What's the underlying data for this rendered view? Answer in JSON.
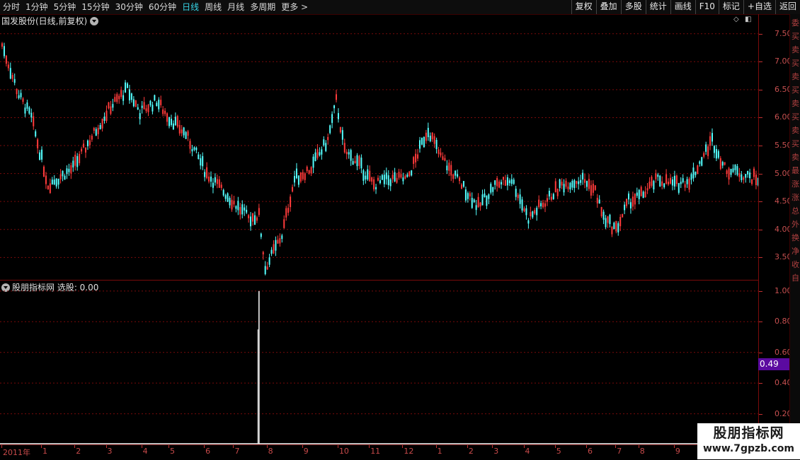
{
  "toolbar": {
    "periods": [
      {
        "label": "分时",
        "active": false
      },
      {
        "label": "1分钟",
        "active": false
      },
      {
        "label": "5分钟",
        "active": false
      },
      {
        "label": "15分钟",
        "active": false
      },
      {
        "label": "30分钟",
        "active": false
      },
      {
        "label": "60分钟",
        "active": false
      },
      {
        "label": "日线",
        "active": true
      },
      {
        "label": "周线",
        "active": false
      },
      {
        "label": "月线",
        "active": false
      },
      {
        "label": "多周期",
        "active": false
      },
      {
        "label": "更多 >",
        "active": false
      }
    ],
    "right_tools": [
      "复权",
      "叠加",
      "多股",
      "统计",
      "画线",
      "F10",
      "标记",
      "+自选",
      "返回"
    ]
  },
  "main_panel": {
    "title": "国发股份(日线,前复权)",
    "y_ticks": [
      "7.50",
      "7.00",
      "6.50",
      "6.00",
      "5.50",
      "5.00",
      "4.50",
      "4.00",
      "3.50"
    ],
    "colors": {
      "up": "#ff3b3b",
      "down": "#54ffff",
      "grid": "#7a0b0b"
    }
  },
  "sub_panel": {
    "title": "股朋指标网 选股: 0.00",
    "y_ticks": [
      "1.00",
      "0.80",
      "0.60",
      "0.40",
      "0.20"
    ],
    "current_value": "0.49"
  },
  "date_axis": {
    "labels": [
      "2011年",
      "1",
      "2",
      "3",
      "4",
      "5",
      "6",
      "7",
      "8",
      "9",
      "10",
      "11",
      "12",
      "1",
      "2",
      "3",
      "4",
      "5",
      "6",
      "7",
      "8",
      "9"
    ]
  },
  "side_strip": {
    "chars": [
      "委",
      "买",
      "卖",
      "买",
      "卖",
      "买",
      "卖",
      "买",
      "卖",
      "买",
      "卖",
      "最",
      "涨",
      "涨",
      "总",
      "外",
      "换",
      "净",
      "收",
      "自"
    ]
  },
  "chart_data": {
    "type": "candlestick",
    "title": "国发股份(日线,前复权)",
    "ylim": [
      3.1,
      7.85
    ],
    "anchors": [
      [
        0,
        7.3
      ],
      [
        8,
        6.4
      ],
      [
        14,
        6.0
      ],
      [
        22,
        4.8
      ],
      [
        34,
        5.1
      ],
      [
        42,
        5.6
      ],
      [
        52,
        6.2
      ],
      [
        60,
        6.5
      ],
      [
        66,
        6.1
      ],
      [
        74,
        6.3
      ],
      [
        80,
        6.0
      ],
      [
        88,
        5.7
      ],
      [
        98,
        5.0
      ],
      [
        108,
        4.6
      ],
      [
        118,
        4.2
      ],
      [
        123,
        4.25
      ],
      [
        126,
        3.3
      ],
      [
        134,
        3.9
      ],
      [
        140,
        4.9
      ],
      [
        148,
        5.1
      ],
      [
        156,
        5.6
      ],
      [
        160,
        6.3
      ],
      [
        164,
        5.4
      ],
      [
        170,
        5.2
      ],
      [
        178,
        4.8
      ],
      [
        186,
        4.9
      ],
      [
        194,
        4.9
      ],
      [
        204,
        5.8
      ],
      [
        210,
        5.3
      ],
      [
        220,
        4.8
      ],
      [
        228,
        4.4
      ],
      [
        236,
        4.8
      ],
      [
        244,
        4.9
      ],
      [
        252,
        4.2
      ],
      [
        260,
        4.5
      ],
      [
        268,
        4.8
      ],
      [
        278,
        4.9
      ],
      [
        284,
        4.7
      ],
      [
        288,
        4.2
      ],
      [
        294,
        4.0
      ],
      [
        300,
        4.5
      ],
      [
        306,
        4.6
      ],
      [
        314,
        4.9
      ],
      [
        322,
        4.8
      ],
      [
        330,
        4.9
      ],
      [
        334,
        5.2
      ],
      [
        340,
        5.6
      ],
      [
        346,
        5.1
      ],
      [
        354,
        5.0
      ],
      [
        362,
        4.9
      ]
    ],
    "signal": {
      "bar_index": 123,
      "value": 1.0
    },
    "indicator_ylim": [
      0,
      1.05
    ],
    "date_positions": [
      0,
      19,
      35,
      50,
      67,
      80,
      97,
      111,
      127,
      144,
      161,
      176,
      192,
      208,
      223,
      235,
      250,
      265,
      280,
      294,
      305,
      322
    ]
  }
}
